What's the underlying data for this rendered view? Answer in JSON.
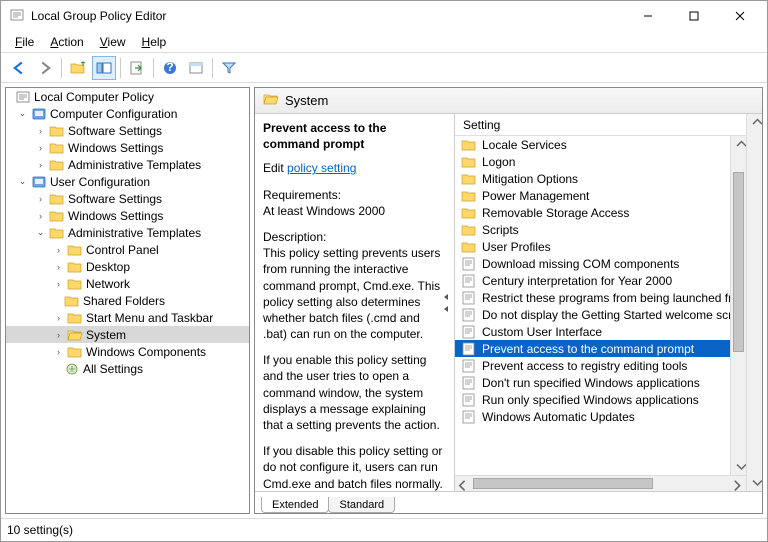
{
  "window": {
    "title": "Local Group Policy Editor"
  },
  "menubar": {
    "file": "File",
    "action": "Action",
    "view": "View",
    "help": "Help",
    "file_u": "F",
    "action_u": "A",
    "view_u": "V",
    "help_u": "H"
  },
  "tree": {
    "root": "Local Computer Policy",
    "computer": {
      "label": "Computer Configuration",
      "software": "Software Settings",
      "windows": "Windows Settings",
      "admin": "Administrative Templates"
    },
    "user": {
      "label": "User Configuration",
      "software": "Software Settings",
      "windows": "Windows Settings",
      "admin": {
        "label": "Administrative Templates",
        "cp": "Control Panel",
        "desktop": "Desktop",
        "network": "Network",
        "shared": "Shared Folders",
        "start": "Start Menu and Taskbar",
        "system": "System",
        "wincomp": "Windows Components",
        "all": "All Settings"
      }
    }
  },
  "header": {
    "title": "System"
  },
  "desc": {
    "title": "Prevent access to the command prompt",
    "edit_prefix": "Edit ",
    "link": "policy setting",
    "req_label": "Requirements:",
    "req_value": "At least Windows 2000",
    "desc_label": "Description:",
    "p1": "This policy setting prevents users from running the interactive command prompt, Cmd.exe.  This policy setting also determines whether batch files (.cmd and .bat) can run on the computer.",
    "p2": "If you enable this policy setting and the user tries to open a command window, the system displays a message explaining that a setting prevents the action.",
    "p3": "If you disable this policy setting or do not configure it, users can run Cmd.exe and batch files normally."
  },
  "list": {
    "header": "Setting",
    "items": [
      {
        "type": "folder",
        "label": "Locale Services"
      },
      {
        "type": "folder",
        "label": "Logon"
      },
      {
        "type": "folder",
        "label": "Mitigation Options"
      },
      {
        "type": "folder",
        "label": "Power Management"
      },
      {
        "type": "folder",
        "label": "Removable Storage Access"
      },
      {
        "type": "folder",
        "label": "Scripts"
      },
      {
        "type": "folder",
        "label": "User Profiles"
      },
      {
        "type": "policy",
        "label": "Download missing COM components"
      },
      {
        "type": "policy",
        "label": "Century interpretation for Year 2000"
      },
      {
        "type": "policy",
        "label": "Restrict these programs from being launched from Help"
      },
      {
        "type": "policy",
        "label": "Do not display the Getting Started welcome screen at logon"
      },
      {
        "type": "policy",
        "label": "Custom User Interface"
      },
      {
        "type": "policy",
        "label": "Prevent access to the command prompt",
        "selected": true
      },
      {
        "type": "policy",
        "label": "Prevent access to registry editing tools"
      },
      {
        "type": "policy",
        "label": "Don't run specified Windows applications"
      },
      {
        "type": "policy",
        "label": "Run only specified Windows applications"
      },
      {
        "type": "policy",
        "label": "Windows Automatic Updates"
      }
    ]
  },
  "tabs": {
    "extended": "Extended",
    "standard": "Standard"
  },
  "status": {
    "text": "10 setting(s)"
  }
}
